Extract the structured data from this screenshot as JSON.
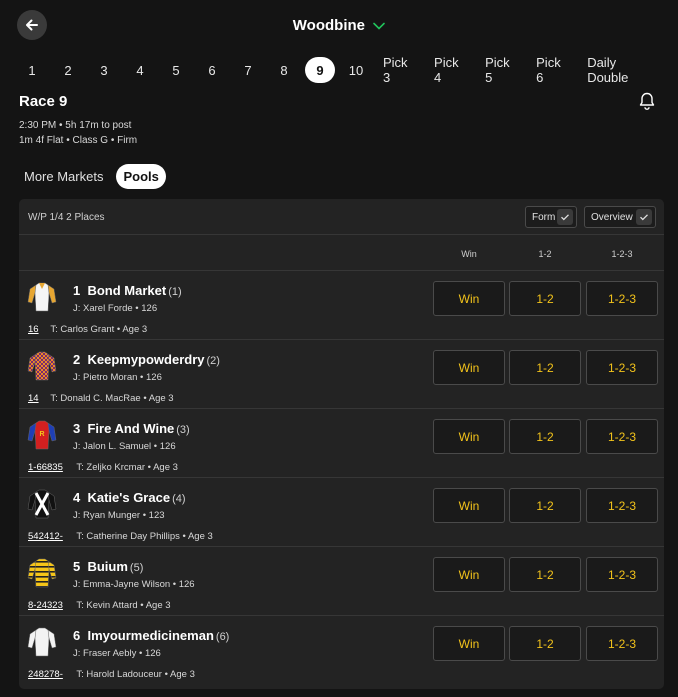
{
  "header": {
    "venue": "Woodbine"
  },
  "race_tabs": [
    "1",
    "2",
    "3",
    "4",
    "5",
    "6",
    "7",
    "8",
    "9",
    "10",
    "Pick 3",
    "Pick 4",
    "Pick 5",
    "Pick 6",
    "Daily Double"
  ],
  "active_tab": "9",
  "race": {
    "title": "Race 9",
    "time_line": "2:30 PM • 5h 17m to post",
    "detail_line": "1m 4f Flat  • Class G  • Firm"
  },
  "subtabs": {
    "more_markets": "More Markets",
    "pools": "Pools"
  },
  "panel": {
    "pool_label": "W/P 1/4 2 Places",
    "form_chip": "Form",
    "overview_chip": "Overview",
    "col_win": "Win",
    "col_exacta": "1-2",
    "col_trifecta": "1-2-3"
  },
  "bet_labels": {
    "win": "Win",
    "exacta": "1-2",
    "trifecta": "1-2-3"
  },
  "runners": [
    {
      "num": "1",
      "name": "Bond Market",
      "barrier": "(1)",
      "jockey": "J: Xarel Forde • 126",
      "form": "16",
      "trainer": "T: Carlos Grant  • Age 3",
      "silk": "white-gold"
    },
    {
      "num": "2",
      "name": "Keepmypowderdry",
      "barrier": "(2)",
      "jockey": "J: Pietro Moran • 126",
      "form": "14",
      "trainer": "T: Donald C. MacRae  • Age 3",
      "silk": "orange-purple-check"
    },
    {
      "num": "3",
      "name": "Fire And Wine",
      "barrier": "(3)",
      "jockey": "J: Jalon L. Samuel • 126",
      "form": "1-66835",
      "trainer": "T: Zeljko Krcmar  • Age 3",
      "silk": "red-blue"
    },
    {
      "num": "4",
      "name": "Katie's Grace",
      "barrier": "(4)",
      "jockey": "J: Ryan Munger • 123",
      "form": "542412-",
      "trainer": "T: Catherine Day Phillips  • Age 3",
      "silk": "black-white-cross"
    },
    {
      "num": "5",
      "name": "Buium",
      "barrier": "(5)",
      "jockey": "J: Emma-Jayne Wilson • 126",
      "form": "8-24323",
      "trainer": "T: Kevin Attard  • Age 3",
      "silk": "yellow-black-hoops"
    },
    {
      "num": "6",
      "name": "Imyourmedicineman",
      "barrier": "(6)",
      "jockey": "J: Fraser Aebly • 126",
      "form": "248278-",
      "trainer": "T: Harold Ladouceur  • Age 3",
      "silk": "white"
    }
  ],
  "colors": {
    "accent": "#f3c31b",
    "check": "#21c35b",
    "background": "#141414",
    "panel": "#232323"
  }
}
